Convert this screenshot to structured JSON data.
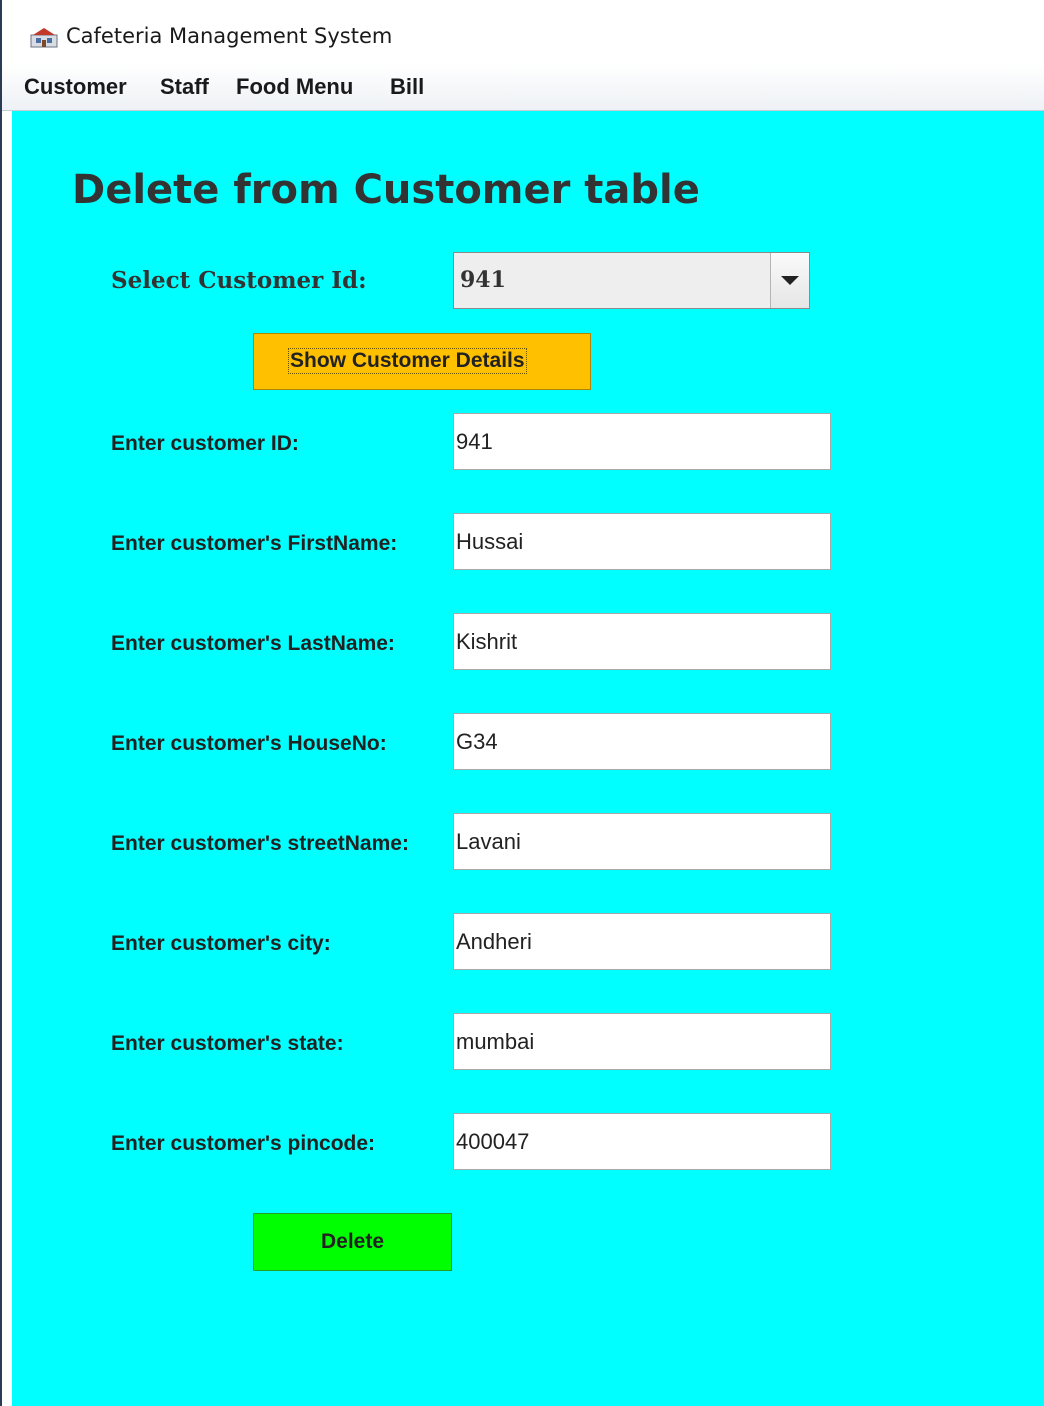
{
  "window": {
    "title": "Cafeteria Management System",
    "icon": "app-logo-icon"
  },
  "menubar": {
    "items": [
      "Customer",
      "Staff",
      "Food Menu",
      "Bill"
    ]
  },
  "form": {
    "heading": "Delete from Customer table",
    "select_label": "Select Customer Id:",
    "selected_id": "941",
    "show_button_label": "Show Customer Details",
    "fields": [
      {
        "label": "Enter customer ID:",
        "value": "941"
      },
      {
        "label": "Enter customer's FirstName:",
        "value": "Hussai"
      },
      {
        "label": "Enter customer's LastName:",
        "value": "Kishrit"
      },
      {
        "label": "Enter customer's HouseNo:",
        "value": "G34"
      },
      {
        "label": "Enter customer's streetName:",
        "value": "Lavani"
      },
      {
        "label": "Enter customer's city:",
        "value": "Andheri"
      },
      {
        "label": "Enter customer's state:",
        "value": "mumbai"
      },
      {
        "label": "Enter customer's pincode:",
        "value": "400047"
      }
    ],
    "delete_button_label": "Delete"
  },
  "colors": {
    "background": "#00ffff",
    "show_button": "#ffc000",
    "delete_button": "#00ff00"
  }
}
